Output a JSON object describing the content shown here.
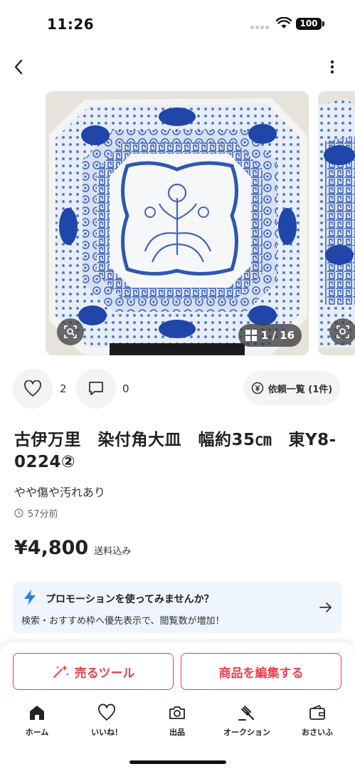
{
  "status": {
    "time": "11:26",
    "battery": "100"
  },
  "gallery": {
    "counter": "1 / 16"
  },
  "actions": {
    "like_count": "2",
    "comment_count": "0",
    "request_label": "依頼一覧 (1件)"
  },
  "item": {
    "title": "古伊万里　染付角大皿　幅約35㎝　東Y8-0224②",
    "condition": "やや傷や汚れあり",
    "time_ago": "57分前",
    "price": "¥4,800",
    "price_note": "送料込み"
  },
  "promo": {
    "title": "プロモーションを使ってみませんか？",
    "subtitle": "検索・おすすめ枠へ優先表示で、閲覧数が増加！"
  },
  "buttons": {
    "sell_tool": "売るツール",
    "edit_item": "商品を編集する"
  },
  "tabs": [
    {
      "label": "ホーム",
      "icon": "home-icon"
    },
    {
      "label": "いいね！",
      "icon": "heart-icon"
    },
    {
      "label": "出品",
      "icon": "camera-icon"
    },
    {
      "label": "オークション",
      "icon": "gavel-icon"
    },
    {
      "label": "おさいふ",
      "icon": "wallet-icon"
    }
  ],
  "colors": {
    "accent": "#e8404a",
    "promo_bg": "#eef5fc",
    "bolt": "#2b7ff0",
    "porcelain_blue": "#2f56b0"
  }
}
